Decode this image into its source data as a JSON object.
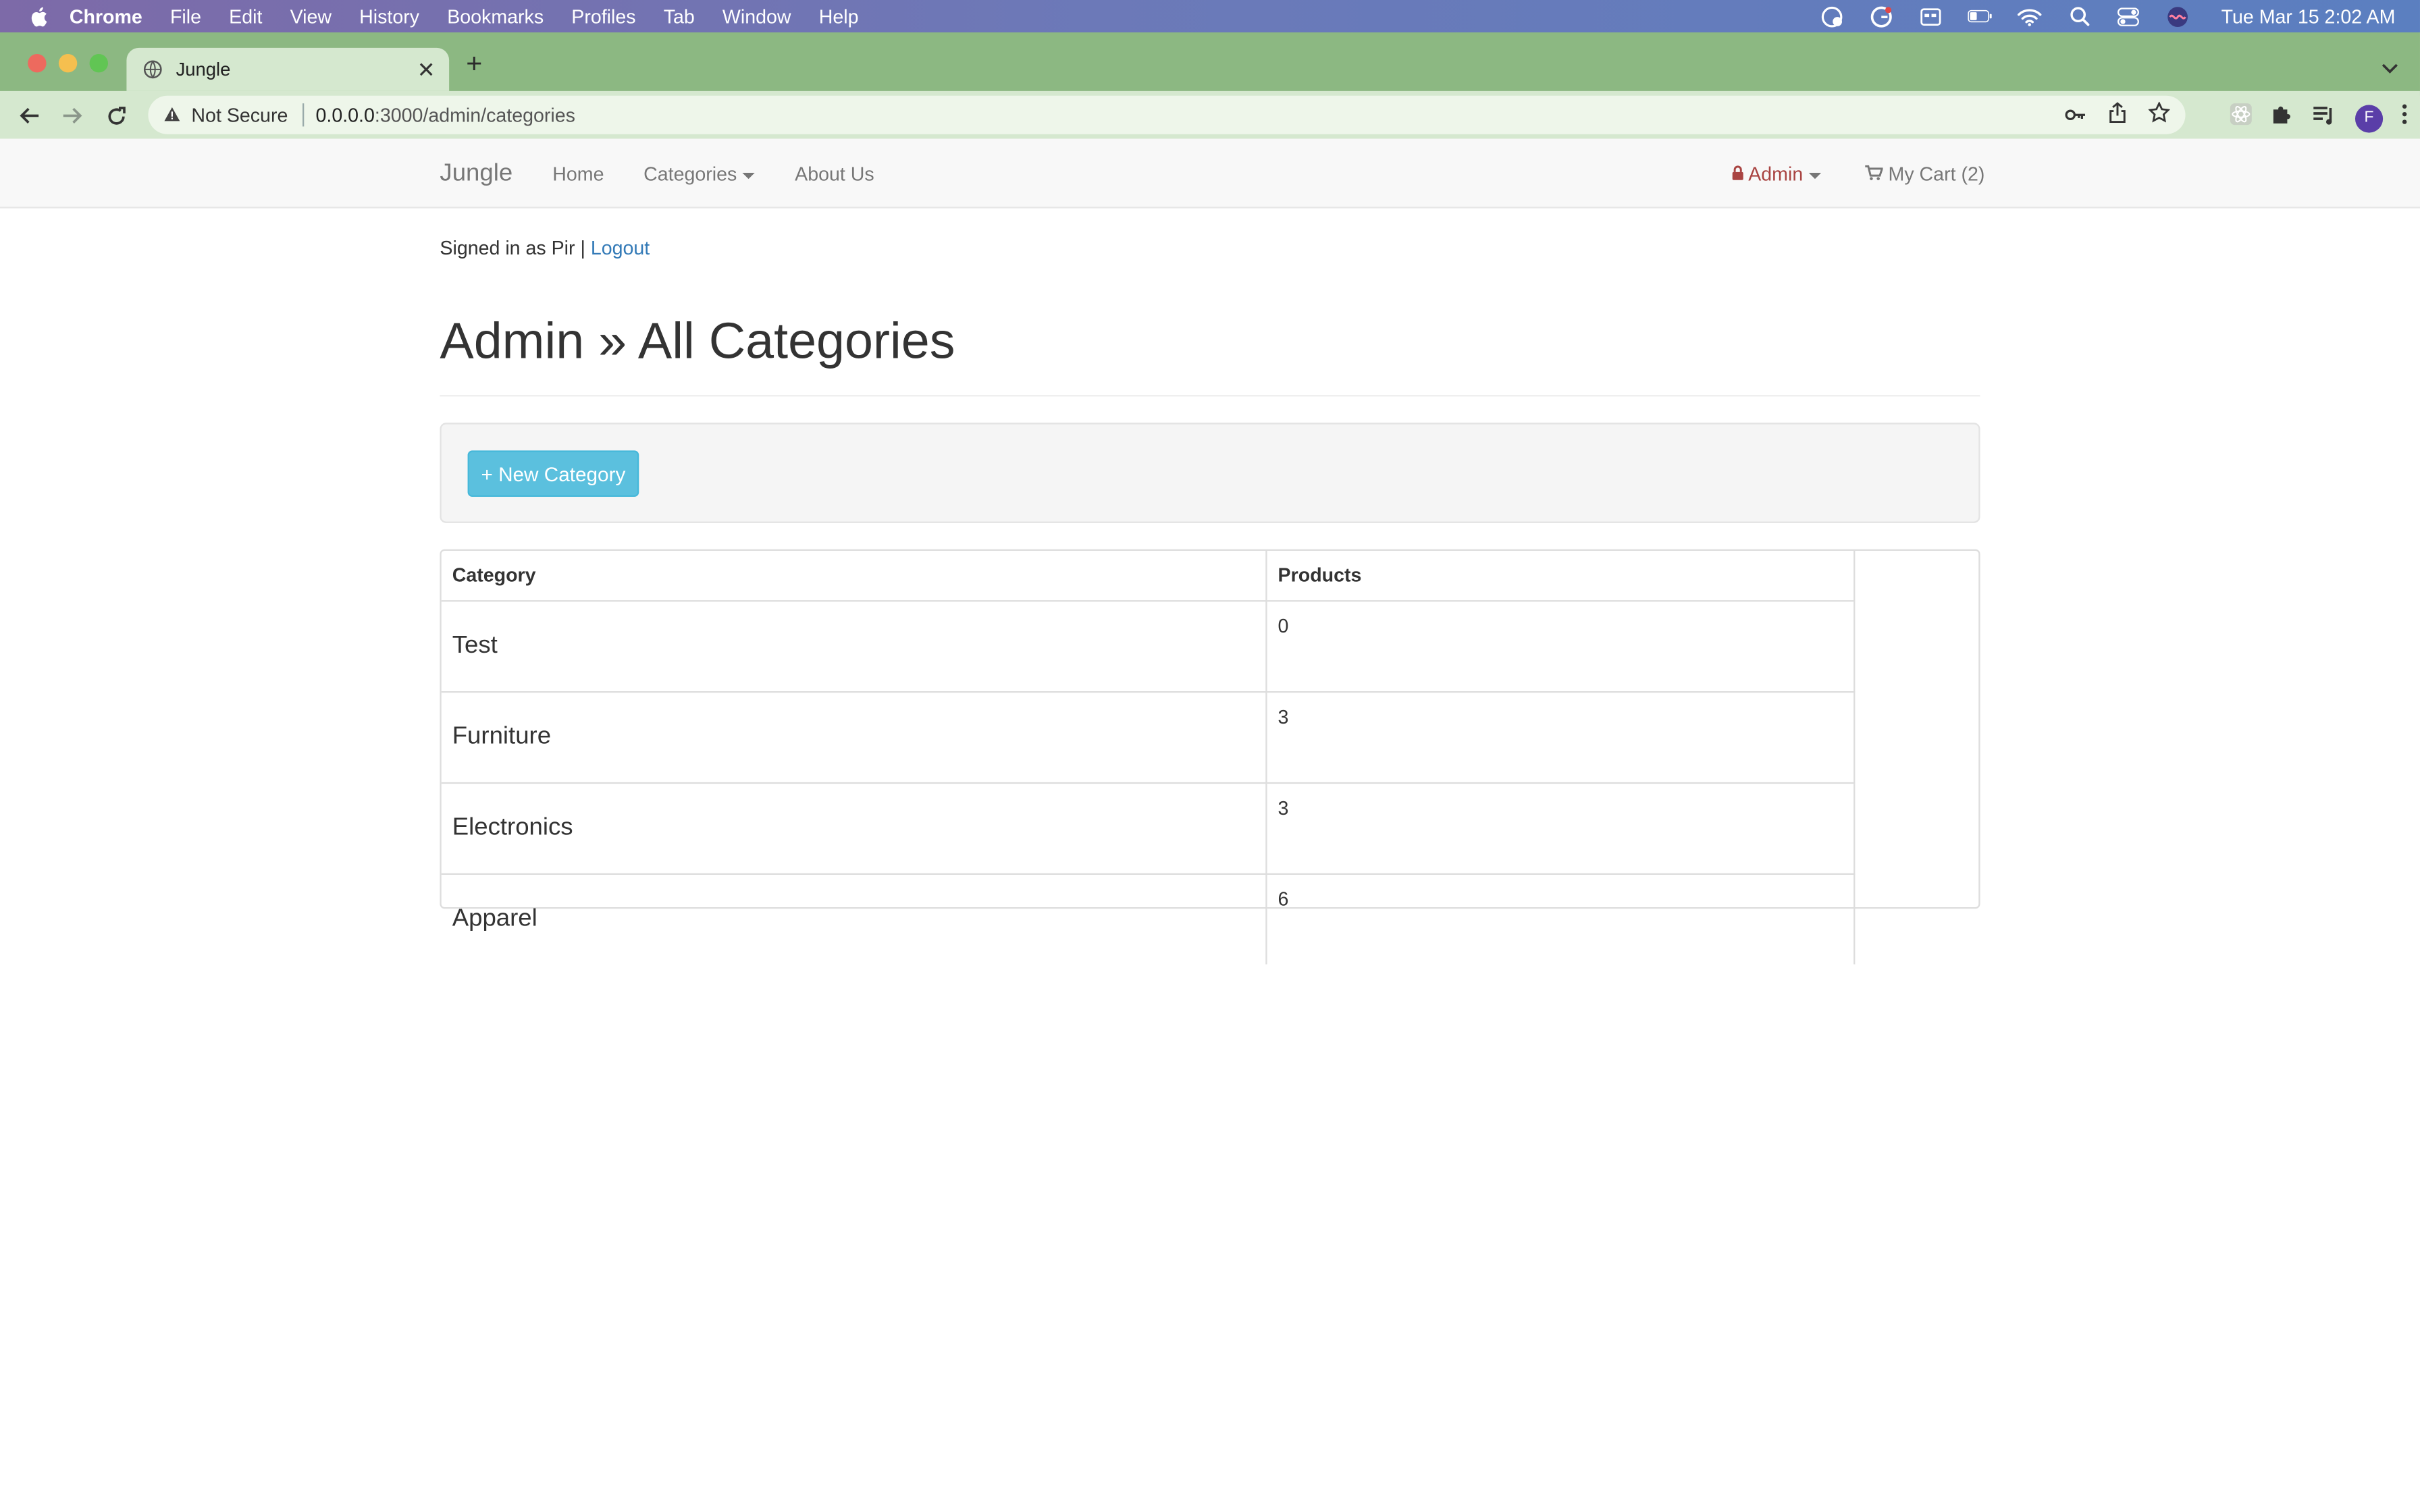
{
  "menubar": {
    "app": "Chrome",
    "items": [
      "File",
      "Edit",
      "View",
      "History",
      "Bookmarks",
      "Profiles",
      "Tab",
      "Window",
      "Help"
    ],
    "clock": "Tue Mar 15  2:02 AM"
  },
  "browser": {
    "tab_title": "Jungle",
    "security_label": "Not Secure",
    "url_host": "0.0.0.0",
    "url_path": ":3000/admin/categories",
    "profile_initial": "F"
  },
  "navbar": {
    "brand": "Jungle",
    "home": "Home",
    "categories": "Categories",
    "about": "About Us",
    "admin": "Admin",
    "cart": "My Cart (2)"
  },
  "session": {
    "signed_in_text": "Signed in as Pir | ",
    "logout": "Logout"
  },
  "page": {
    "title": "Admin » All Categories",
    "new_button": "+ New Category"
  },
  "table": {
    "headers": [
      "Category",
      "Products"
    ],
    "rows": [
      {
        "name": "Test",
        "products": "0"
      },
      {
        "name": "Furniture",
        "products": "3"
      },
      {
        "name": "Electronics",
        "products": "3"
      },
      {
        "name": "Apparel",
        "products": "6"
      }
    ]
  }
}
